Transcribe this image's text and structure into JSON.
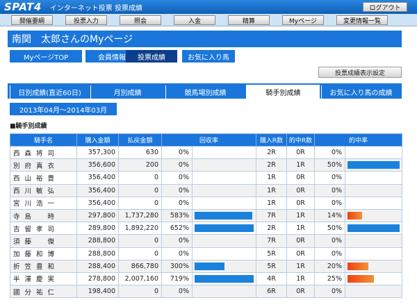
{
  "app": {
    "logo": "SPAT4",
    "title": "インターネット投票 投票成績",
    "logout_label": "ログアウト"
  },
  "menu": [
    "開催要綱",
    "投票入力",
    "照会",
    "入金",
    "精算",
    "Myページ",
    "変更情報一覧"
  ],
  "page": {
    "title": "南関　太郎さんのMyページ"
  },
  "subnav": [
    {
      "label": "MyページTOP",
      "active": false
    },
    {
      "label": "会員情報",
      "active": false
    },
    {
      "label": "投票成績",
      "active": true
    },
    {
      "label": "お気に入り馬",
      "active": false
    }
  ],
  "display_setting_label": "投票成績表示設定",
  "tabs": [
    {
      "label": "日別成績(直近60日)",
      "active": false
    },
    {
      "label": "月別成績",
      "active": false
    },
    {
      "label": "競馬場別成績",
      "active": false
    },
    {
      "label": "騎手別成績",
      "active": true
    },
    {
      "label": "お気に入り馬の成績",
      "active": false
    }
  ],
  "period": "2013年04月～2014年03月",
  "section_label": "■騎手別成績",
  "colors": {
    "accent": "#1a76da",
    "accent_dark": "#0c3e8a",
    "bar": "#1a82dc",
    "bar_hot": "#f04010"
  },
  "table": {
    "headers": [
      "騎手名",
      "購入金額",
      "払戻金額",
      "回収率",
      "購入R数",
      "的中R数",
      "的中率"
    ],
    "rows": [
      {
        "name": "西 森 将 司",
        "purchase": "357,300",
        "payout": "630",
        "recovery": "0%",
        "recovery_value": 0,
        "races": "2R",
        "hits": "0R",
        "hit_rate": "0%",
        "hit_value": 0
      },
      {
        "name": "別 府 真 衣",
        "purchase": "356,600",
        "payout": "200",
        "recovery": "0%",
        "recovery_value": 0,
        "races": "2R",
        "hits": "1R",
        "hit_rate": "50%",
        "hit_value": 50
      },
      {
        "name": "西 山 裕 貴",
        "purchase": "356,400",
        "payout": "0",
        "recovery": "0%",
        "recovery_value": 0,
        "races": "1R",
        "hits": "0R",
        "hit_rate": "0%",
        "hit_value": 0
      },
      {
        "name": "西 川 敏 弘",
        "purchase": "356,400",
        "payout": "0",
        "recovery": "0%",
        "recovery_value": 0,
        "races": "1R",
        "hits": "0R",
        "hit_rate": "0%",
        "hit_value": 0
      },
      {
        "name": "宮 川 浩 一",
        "purchase": "356,400",
        "payout": "0",
        "recovery": "0%",
        "recovery_value": 0,
        "races": "1R",
        "hits": "0R",
        "hit_rate": "0%",
        "hit_value": 0
      },
      {
        "name": "寺 島 　 時",
        "purchase": "297,800",
        "payout": "1,737,280",
        "recovery": "583%",
        "recovery_value": 583,
        "races": "7R",
        "hits": "1R",
        "hit_rate": "14%",
        "hit_value": 14
      },
      {
        "name": "吉 留 孝 司",
        "purchase": "289,800",
        "payout": "1,892,220",
        "recovery": "652%",
        "recovery_value": 652,
        "races": "2R",
        "hits": "1R",
        "hit_rate": "50%",
        "hit_value": 50
      },
      {
        "name": "須 藤 　 傑",
        "purchase": "288,800",
        "payout": "0",
        "recovery": "0%",
        "recovery_value": 0,
        "races": "7R",
        "hits": "0R",
        "hit_rate": "0%",
        "hit_value": 0
      },
      {
        "name": "加 藤 和 博",
        "purchase": "288,800",
        "payout": "0",
        "recovery": "0%",
        "recovery_value": 0,
        "races": "5R",
        "hits": "0R",
        "hit_rate": "0%",
        "hit_value": 0
      },
      {
        "name": "折 笠 豊 和",
        "purchase": "288,400",
        "payout": "866,780",
        "recovery": "300%",
        "recovery_value": 300,
        "races": "5R",
        "hits": "1R",
        "hit_rate": "20%",
        "hit_value": 20
      },
      {
        "name": "半 澤 慶 実",
        "purchase": "278,800",
        "payout": "2,007,160",
        "recovery": "719%",
        "recovery_value": 719,
        "races": "4R",
        "hits": "1R",
        "hit_rate": "25%",
        "hit_value": 25
      },
      {
        "name": "國 分 祐 仁",
        "purchase": "198,400",
        "payout": "0",
        "recovery": "0%",
        "recovery_value": 0,
        "races": "6R",
        "hits": "0R",
        "hit_rate": "0%",
        "hit_value": 0
      }
    ]
  }
}
